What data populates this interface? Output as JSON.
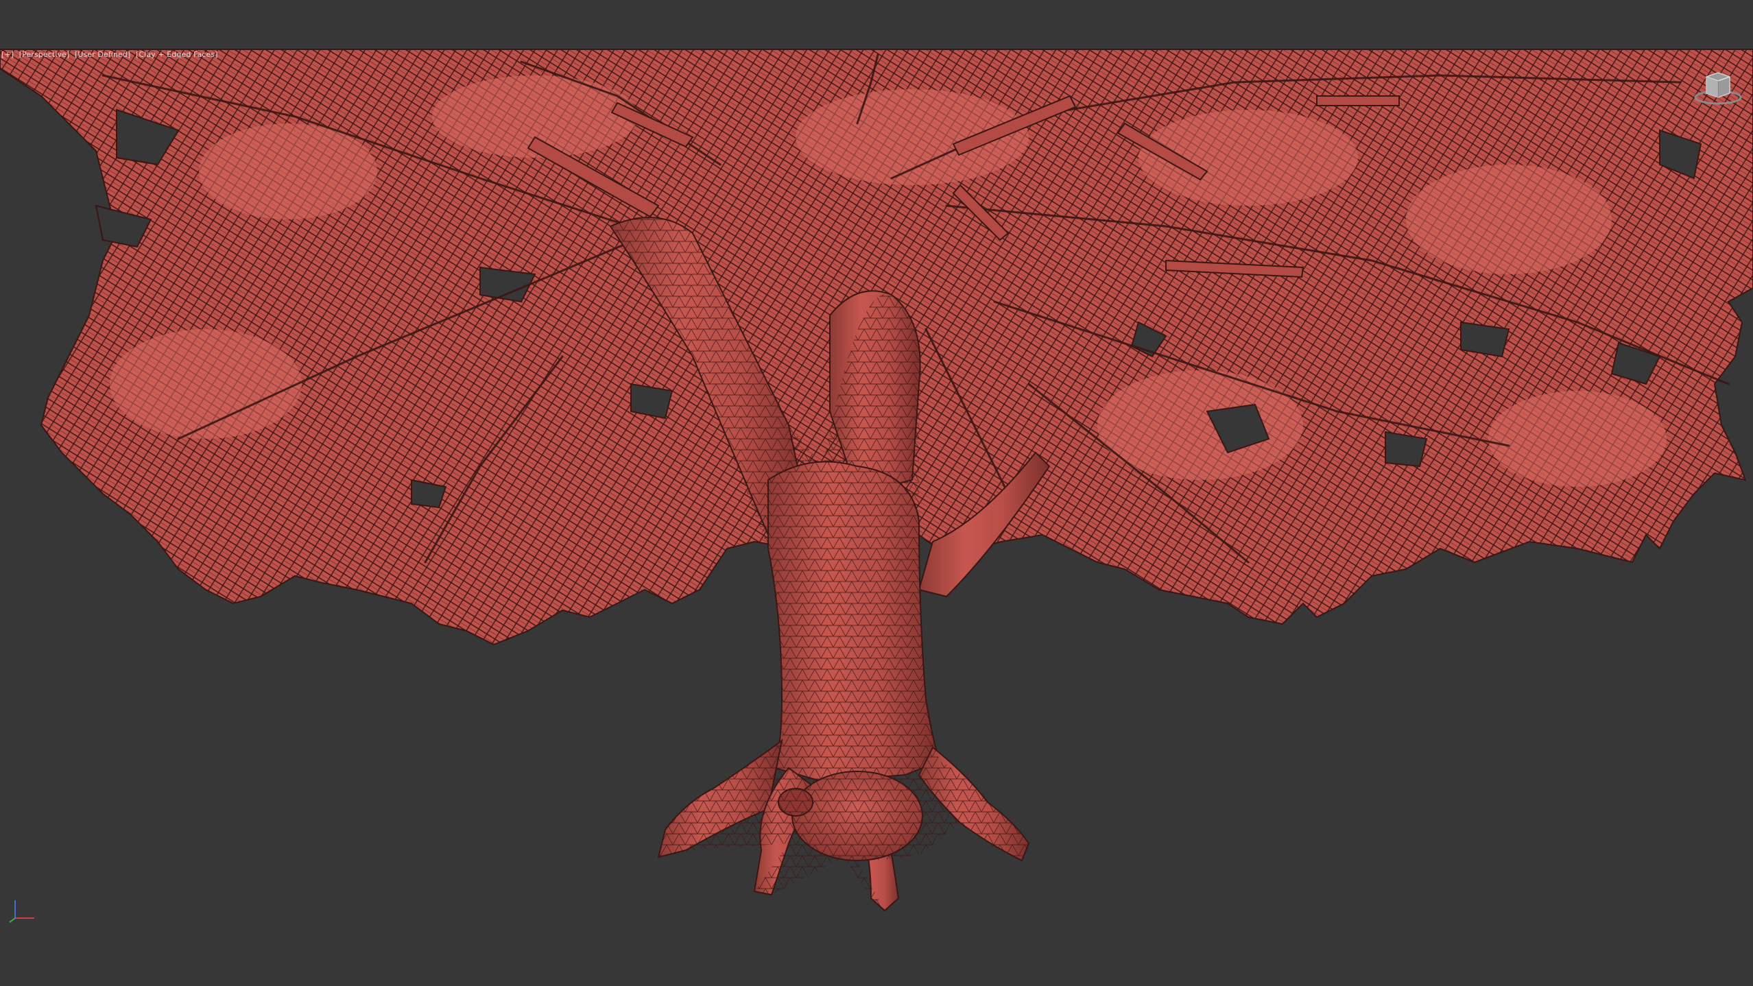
{
  "viewport": {
    "label_parts": [
      "[+]",
      "[Perspective]",
      "[User Defined]",
      "[Clay + Edged Faces]"
    ],
    "background_color": "#373737",
    "mesh_color": "#c0524b",
    "mesh_dark": "#8a3330",
    "wire_color": "#3a1614"
  },
  "icons": {
    "viewcube": "viewcube-icon",
    "axis": "axis-tripod-icon"
  }
}
